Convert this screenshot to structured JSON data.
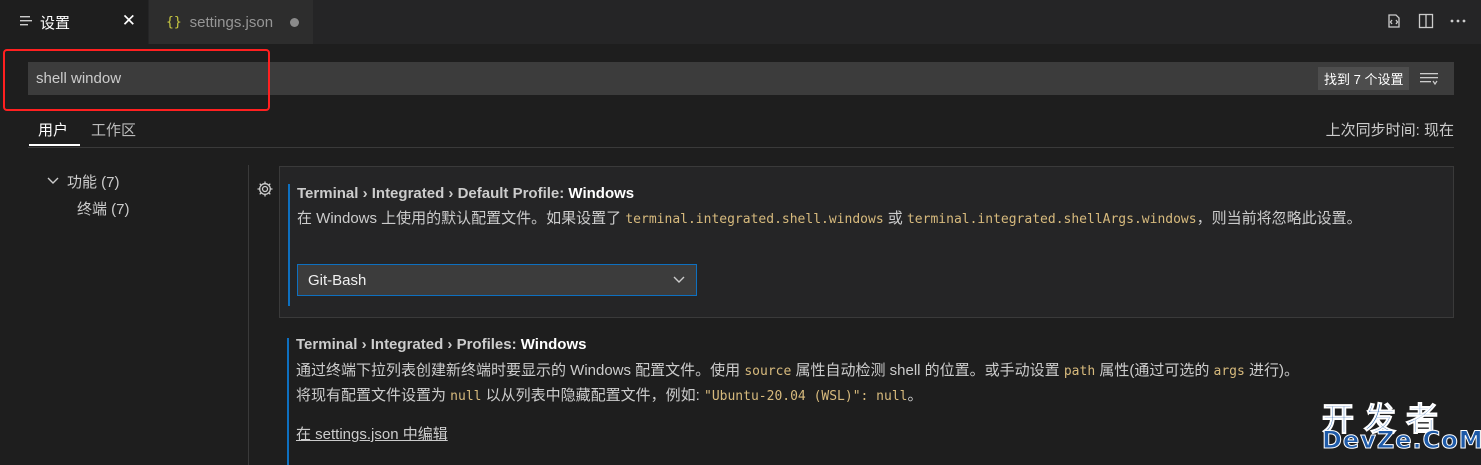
{
  "tabs": {
    "settings": {
      "label": "设置",
      "icon": "list-icon",
      "close": "✕"
    },
    "settings_json": {
      "label": "settings.json",
      "icon_text": "{}"
    }
  },
  "toolbar": {
    "icons": [
      "open-json-icon",
      "split-editor-icon",
      "more-actions-icon"
    ]
  },
  "search": {
    "value": "shell window",
    "result_count": "找到 7 个设置",
    "filter_icon": "filter-icon"
  },
  "scope_tabs": {
    "user": "用户",
    "workspace": "工作区",
    "sync_status": "上次同步时间: 现在"
  },
  "tree": {
    "root": {
      "label": "功能 (7)",
      "expanded": true
    },
    "child": {
      "label": "终端 (7)"
    }
  },
  "settings": [
    {
      "category": "Terminal › Integrated › Default Profile: ",
      "name": "Windows",
      "desc_1": "在 Windows 上使用的默认配置文件。如果设置了 ",
      "code_1": "terminal.integrated.shell.windows",
      "desc_2": " 或 ",
      "code_2": "terminal.integrated.shellArgs.windows",
      "desc_3": "，则当前将忽略此设置。",
      "dropdown_value": "Git-Bash"
    },
    {
      "category": "Terminal › Integrated › Profiles: ",
      "name": "Windows",
      "desc_1": "通过终端下拉列表创建新终端时要显示的 Windows 配置文件。使用 ",
      "code_1": "source",
      "desc_2": " 属性自动检测 shell 的位置。或手动设置 ",
      "code_2": "path",
      "desc_3": " 属性(通过可选的 ",
      "code_3": "args",
      "desc_4": " 进行)。",
      "desc_5": "将现有配置文件设置为 ",
      "code_4": "null",
      "desc_6": " 以从列表中隐藏配置文件，例如: ",
      "code_5": "\"Ubuntu-20.04 (WSL)\": null",
      "desc_7": "。",
      "edit_link": "在 settings.json 中编辑"
    }
  ],
  "watermark": {
    "top": "开发者",
    "bottom": "DevZe.CoM"
  },
  "colors": {
    "accent": "#0e70c0",
    "highlight": "#ff2020",
    "code": "#d7ba7d"
  }
}
